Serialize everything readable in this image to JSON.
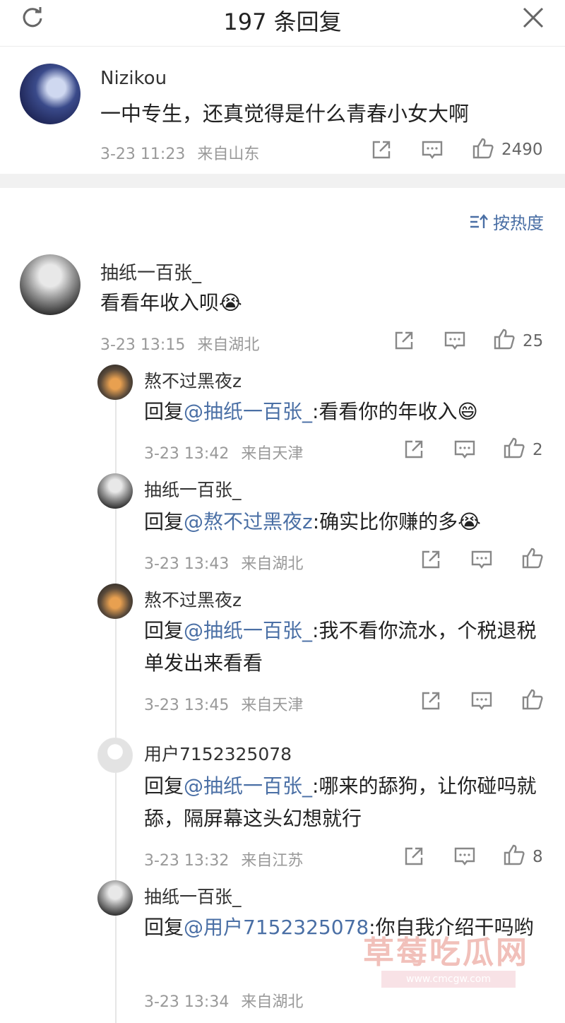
{
  "header": {
    "title": "197 条回复"
  },
  "main_comment": {
    "username": "Nizikou",
    "text": "一中专生，还真觉得是什么青春小女大啊",
    "time": "3-23 11:23",
    "location": "来自山东",
    "likes": "2490"
  },
  "sort": {
    "label": "按热度"
  },
  "reply": {
    "username": "抽纸一百张_",
    "text": "看看年收入呗😭",
    "time": "3-23 13:15",
    "location": "来自湖北",
    "likes": "25"
  },
  "subreplies": [
    {
      "username": "熬不过黑夜z",
      "prefix": "回复",
      "mention": "@抽纸一百张_",
      "text": ":看看你的年收入😄",
      "time": "3-23 13:42",
      "location": "来自天津",
      "likes": "2"
    },
    {
      "username": "抽纸一百张_",
      "prefix": "回复",
      "mention": "@熬不过黑夜z",
      "text": ":确实比你赚的多😭",
      "time": "3-23 13:43",
      "location": "来自湖北",
      "likes": ""
    },
    {
      "username": "熬不过黑夜z",
      "prefix": "回复",
      "mention": "@抽纸一百张_",
      "text": ":我不看你流水，个税退税单发出来看看",
      "time": "3-23 13:45",
      "location": "来自天津",
      "likes": ""
    },
    {
      "username": "用户7152325078",
      "prefix": "回复",
      "mention": "@抽纸一百张_",
      "text": ":哪来的舔狗，让你碰吗就舔，隔屏幕这头幻想就行",
      "time": "3-23 13:32",
      "location": "来自江苏",
      "likes": "8"
    },
    {
      "username": "抽纸一百张_",
      "prefix": "回复",
      "mention": "@用户7152325078",
      "text": ":你自我介绍干吗哟",
      "time": "3-23 13:34",
      "location": "来自湖北",
      "likes": ""
    }
  ],
  "watermark": {
    "text": "草莓吃瓜网",
    "url": "www.cmcgw.com"
  }
}
